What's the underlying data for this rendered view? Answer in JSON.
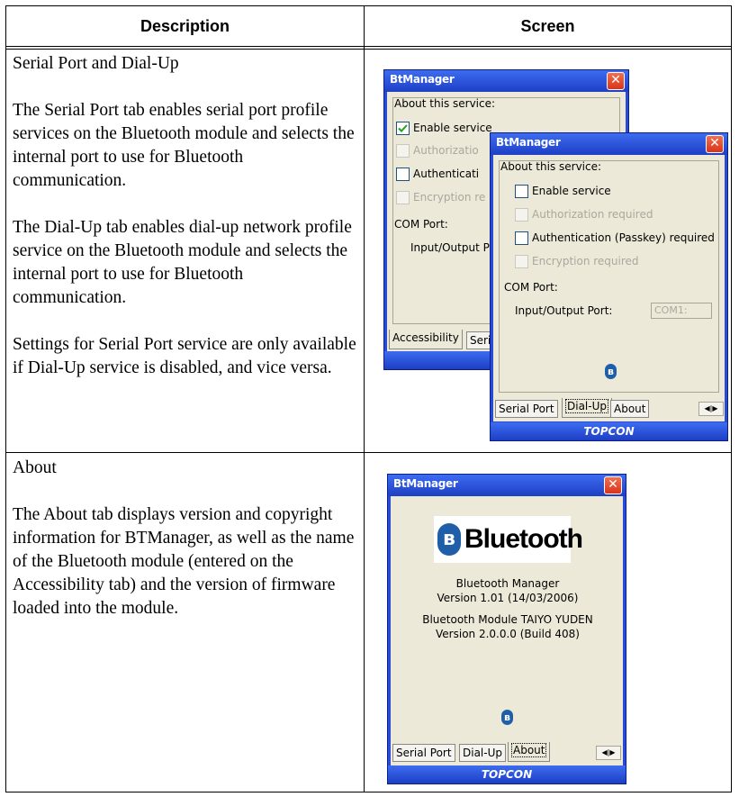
{
  "table": {
    "headers": [
      "Description",
      "Screen"
    ],
    "rows": [
      {
        "title": "Serial Port and Dial-Up",
        "paragraphs": [
          "The Serial Port tab enables serial port profile services on the Bluetooth module and selects the internal port to use for Bluetooth communication.",
          "The Dial-Up tab enables dial-up network profile service on the Bluetooth module and selects the internal port to use for Bluetooth communication.",
          "Settings for Serial Port service are only available if Dial-Up service is disabled, and vice versa."
        ]
      },
      {
        "title": "About",
        "paragraphs": [
          "The About tab displays version and copyright information for BTManager, as well as the name of the Bluetooth module (entered on the Accessibility tab) and the version of firmware loaded into the module."
        ]
      }
    ]
  },
  "screens": {
    "back": {
      "title": "BtManager",
      "about_label": "About this service:",
      "enable": "Enable service",
      "authorization": "Authorizatio",
      "authentication": "Authenticati",
      "encryption": "Encryption re",
      "com_port": "COM Port:",
      "io_port": "Input/Output P",
      "tab_accessibility": "Accessibility",
      "tab_serial": "Seri",
      "footer": "T"
    },
    "front": {
      "title": "BtManager",
      "about_label": "About this service:",
      "enable": "Enable service",
      "authorization": "Authorization required",
      "authentication": "Authentication (Passkey) required",
      "encryption": "Encryption required",
      "com_port": "COM Port:",
      "io_port": "Input/Output Port:",
      "combo_value": "COM1:",
      "tabs": [
        "Serial Port",
        "Dial-Up",
        "About"
      ],
      "footer": "TOPCON"
    },
    "about": {
      "title": "BtManager",
      "logo_text": "Bluetooth",
      "line1": "Bluetooth Manager",
      "line2": "Version 1.01 (14/03/2006)",
      "line3": "Bluetooth Module TAIYO YUDEN",
      "line4": "Version 2.0.0.0 (Build 408)",
      "tabs": [
        "Serial Port",
        "Dial-Up",
        "About"
      ],
      "footer": "TOPCON"
    }
  },
  "icons": {
    "close": "close-icon",
    "checkmark": "checkmark-icon",
    "bluetooth": "bluetooth-icon",
    "scroll_left": "scroll-left-icon",
    "scroll_right": "scroll-right-icon"
  },
  "colors": {
    "titlebar": "#2a4bd6",
    "dialog_bg": "#ece9d8",
    "close": "#d8341a",
    "bluetooth": "#1f5fa8"
  }
}
